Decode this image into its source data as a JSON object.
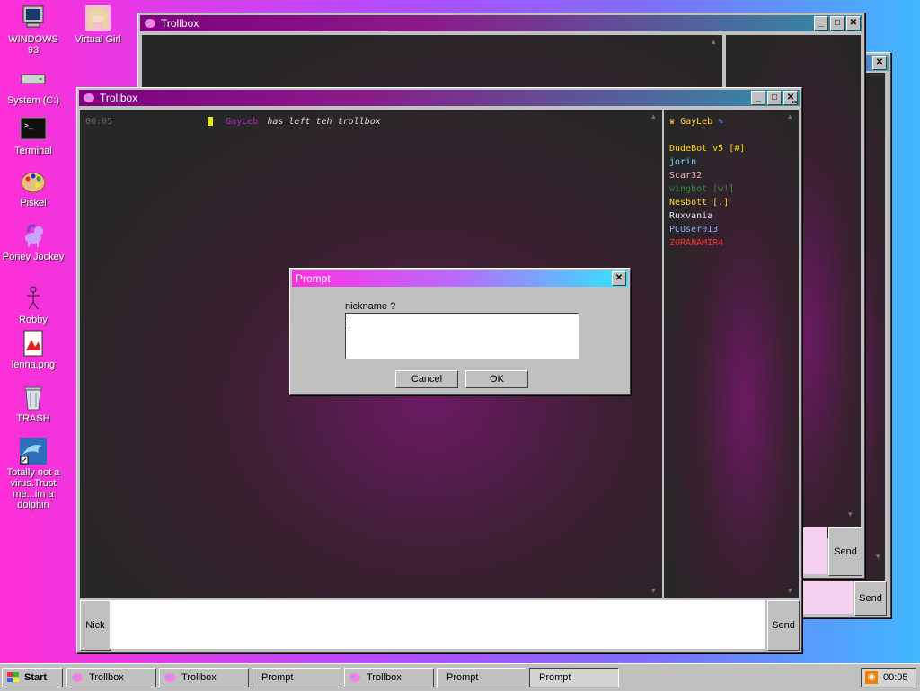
{
  "desktop": {
    "icons": [
      {
        "label": "WINDOWS 93",
        "icon": "computer-icon"
      },
      {
        "label": "Virtual Girl",
        "icon": "girl-icon"
      },
      {
        "label": "System (C:)",
        "icon": "drive-icon"
      },
      {
        "label": "Terminal",
        "icon": "terminal-icon"
      },
      {
        "label": "Piskel",
        "icon": "palette-icon"
      },
      {
        "label": "Poney Jockey",
        "icon": "pony-icon"
      },
      {
        "label": "Robby",
        "icon": "stickman-icon"
      },
      {
        "label": "lenna.png",
        "icon": "image-file-icon"
      },
      {
        "label": "TRASH",
        "icon": "trash-icon"
      },
      {
        "label": "Totally not a virus.Trust me...im a dolphin",
        "icon": "dolphin-icon"
      }
    ]
  },
  "trollbox_back": {
    "title": "Trollbox",
    "send_label": "Send"
  },
  "trollbox_back2": {
    "send_label": "Send"
  },
  "trollbox_front": {
    "title": "Trollbox",
    "log": [
      {
        "time": "00:05",
        "user": "GayLeb",
        "msg": "has left teh trollbox"
      }
    ],
    "current_user": "GayLeb",
    "users": [
      {
        "name": "DudeBot v5 [#]",
        "color": "#ffd700"
      },
      {
        "name": "jorin",
        "color": "#7fd6ff"
      },
      {
        "name": "Scar32",
        "color": "#ffb0b0"
      },
      {
        "name": "wingbot [w!]",
        "color": "#2e8b3a"
      },
      {
        "name": "Nesbott [.]",
        "color": "#ffd23a"
      },
      {
        "name": "Ruxvania",
        "color": "#e8e0ff"
      },
      {
        "name": "PCUser013",
        "color": "#8aa7ff"
      },
      {
        "name": "ZORANAMIR4",
        "color": "#ff2a2a"
      }
    ],
    "nick_label": "Nick",
    "send_label": "Send",
    "message_value": ""
  },
  "prompt": {
    "title": "Prompt",
    "question": "nickname ?",
    "input_value": "",
    "cancel_label": "Cancel",
    "ok_label": "OK"
  },
  "taskbar": {
    "start_label": "Start",
    "items": [
      {
        "label": "Trollbox"
      },
      {
        "label": "Trollbox"
      },
      {
        "label": "Prompt"
      },
      {
        "label": "Trollbox"
      },
      {
        "label": "Prompt"
      },
      {
        "label": "Prompt"
      }
    ],
    "clock": "00:05"
  }
}
